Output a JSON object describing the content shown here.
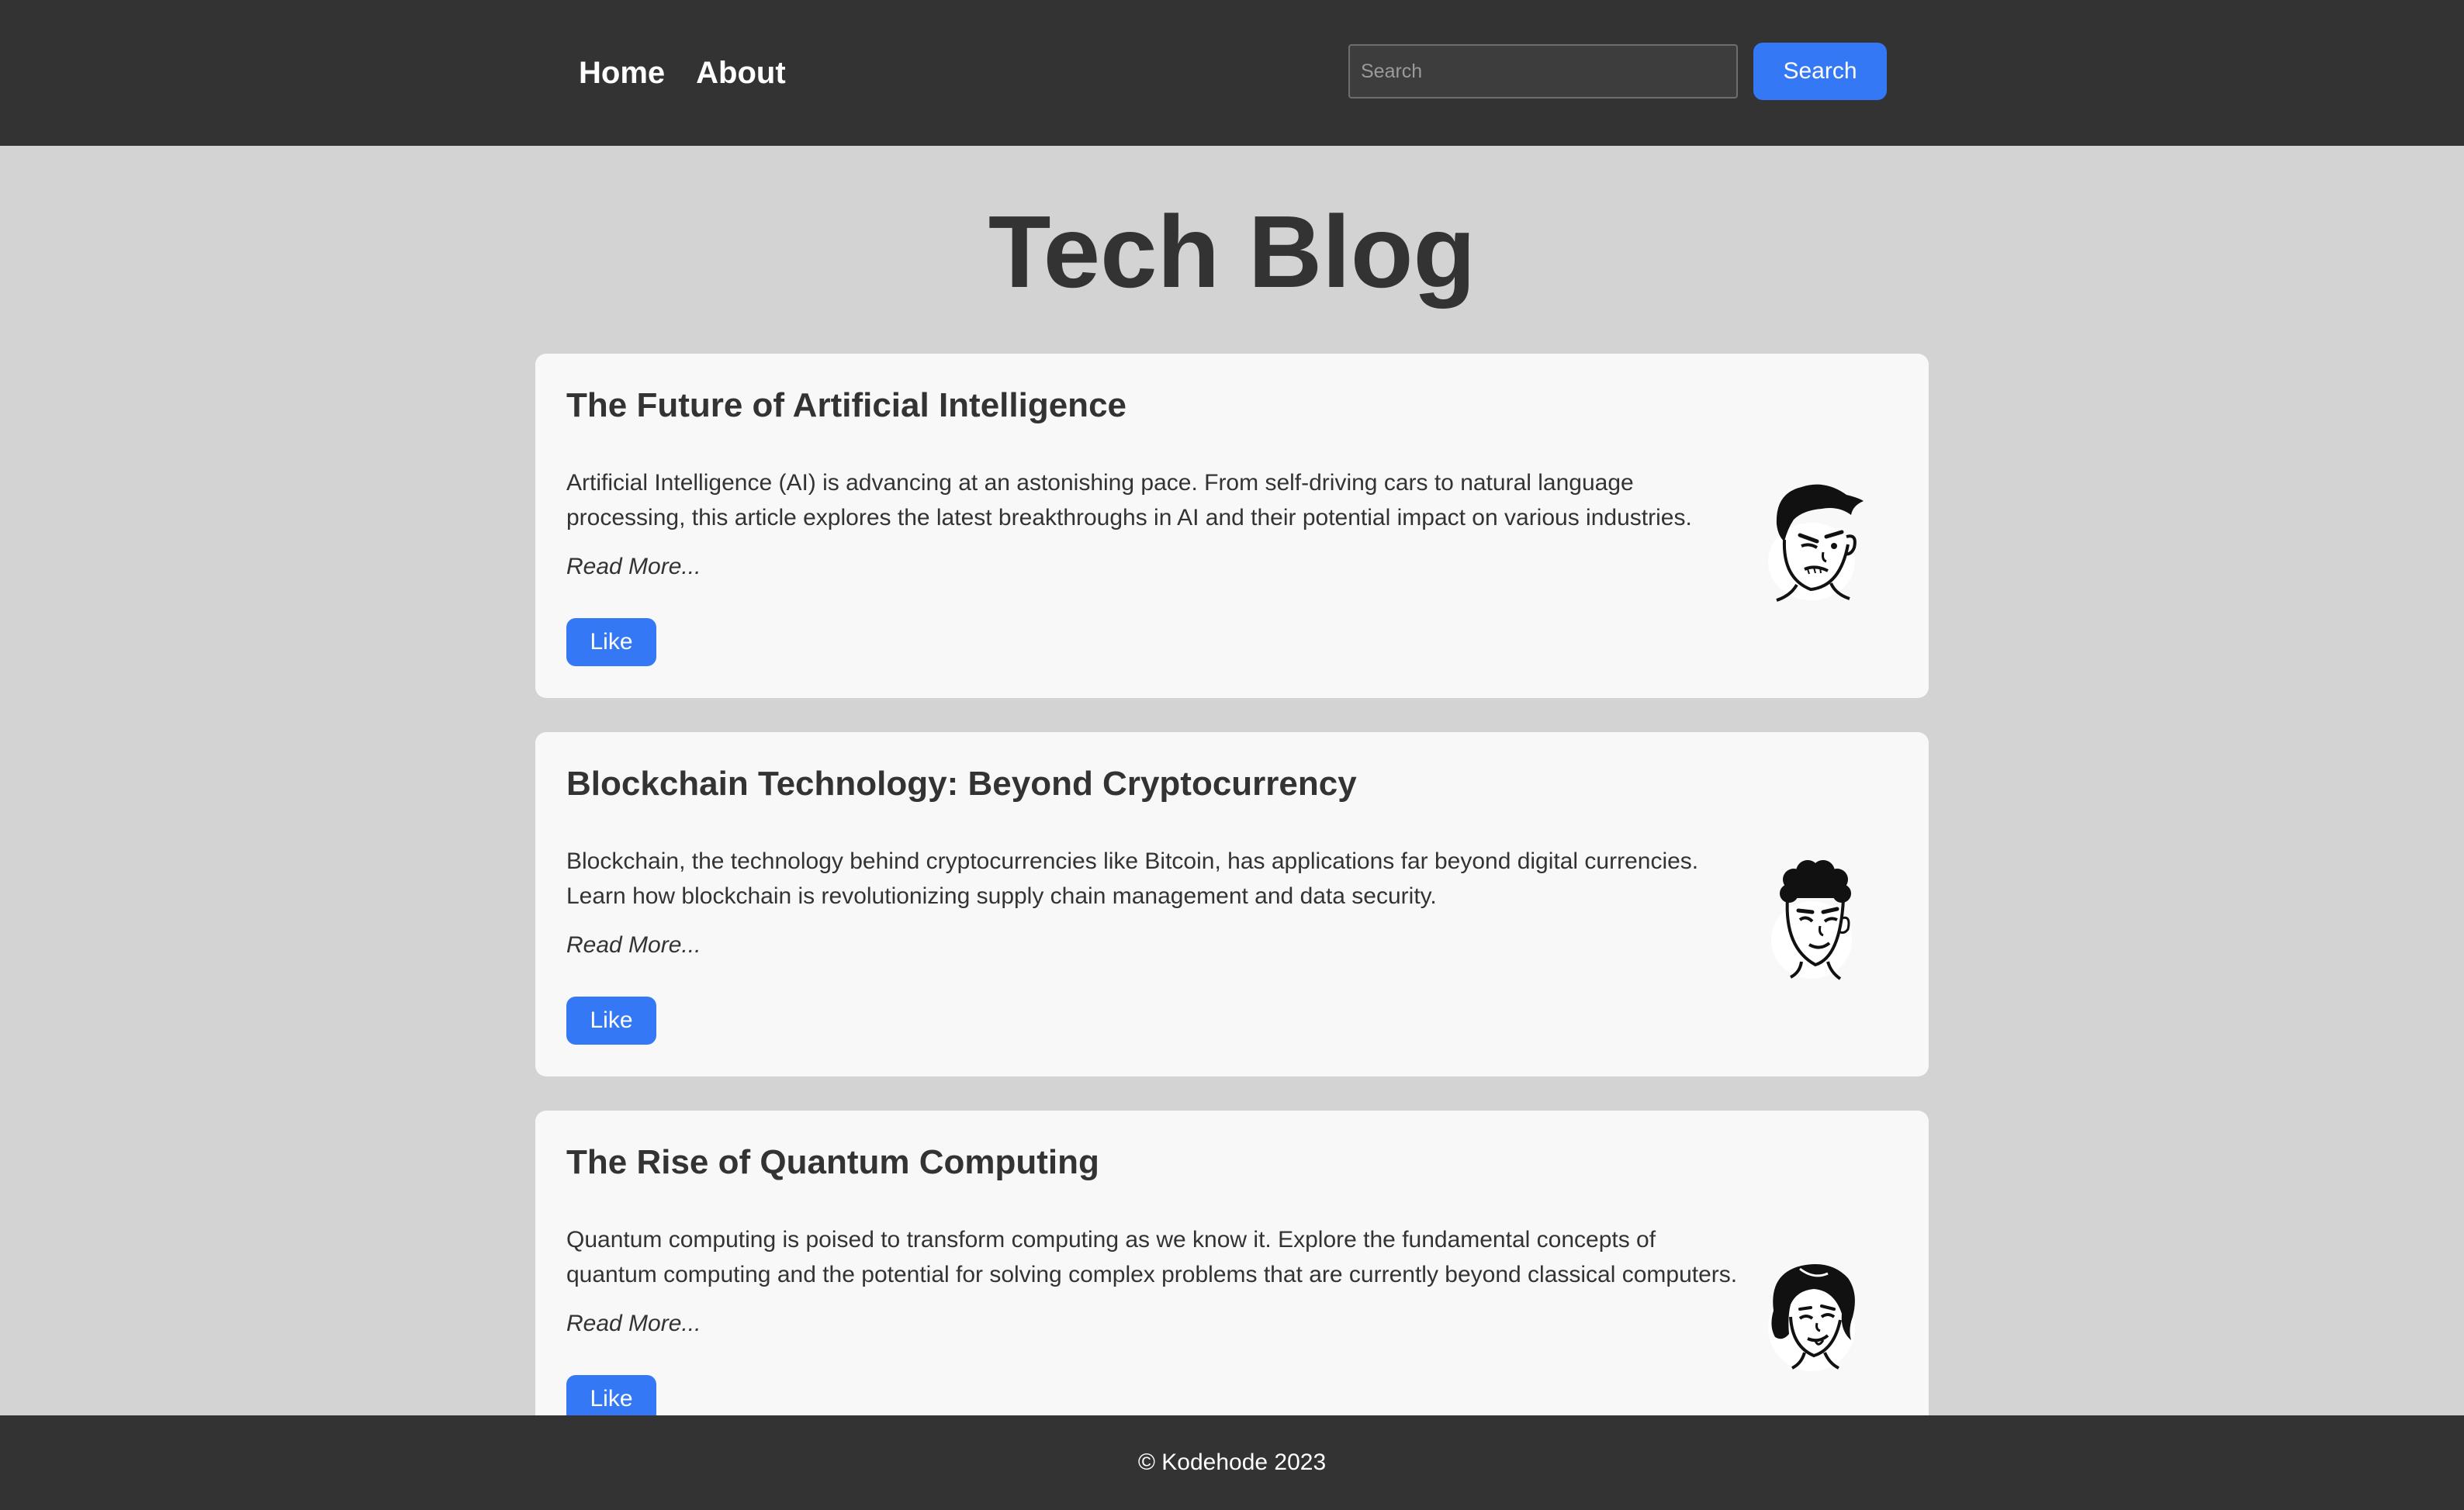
{
  "nav": {
    "home_label": "Home",
    "about_label": "About"
  },
  "search": {
    "placeholder": "Search",
    "button_label": "Search"
  },
  "page": {
    "title": "Tech Blog"
  },
  "posts": [
    {
      "title": "The Future of Artificial Intelligence",
      "excerpt": "Artificial Intelligence (AI) is advancing at an astonishing pace. From self-driving cars to natural language processing, this article explores the latest breakthroughs in AI and their potential impact on various industries.",
      "read_more": "Read More...",
      "like_label": "Like",
      "avatar_icon": "cartoon-man-avatar-icon"
    },
    {
      "title": "Blockchain Technology: Beyond Cryptocurrency",
      "excerpt": "Blockchain, the technology behind cryptocurrencies like Bitcoin, has applications far beyond digital currencies. Learn how blockchain is revolutionizing supply chain management and data security.",
      "read_more": "Read More...",
      "like_label": "Like",
      "avatar_icon": "cartoon-curly-hair-avatar-icon"
    },
    {
      "title": "The Rise of Quantum Computing",
      "excerpt": "Quantum computing is poised to transform computing as we know it. Explore the fundamental concepts of quantum computing and the potential for solving complex problems that are currently beyond classical computers.",
      "read_more": "Read More...",
      "like_label": "Like",
      "avatar_icon": "cartoon-woman-avatar-icon"
    }
  ],
  "footer": {
    "text": "© Kodehode 2023"
  },
  "colors": {
    "header_bg": "#333333",
    "page_bg": "#d3d3d3",
    "card_bg": "#f8f8f8",
    "accent": "#3478f6"
  }
}
